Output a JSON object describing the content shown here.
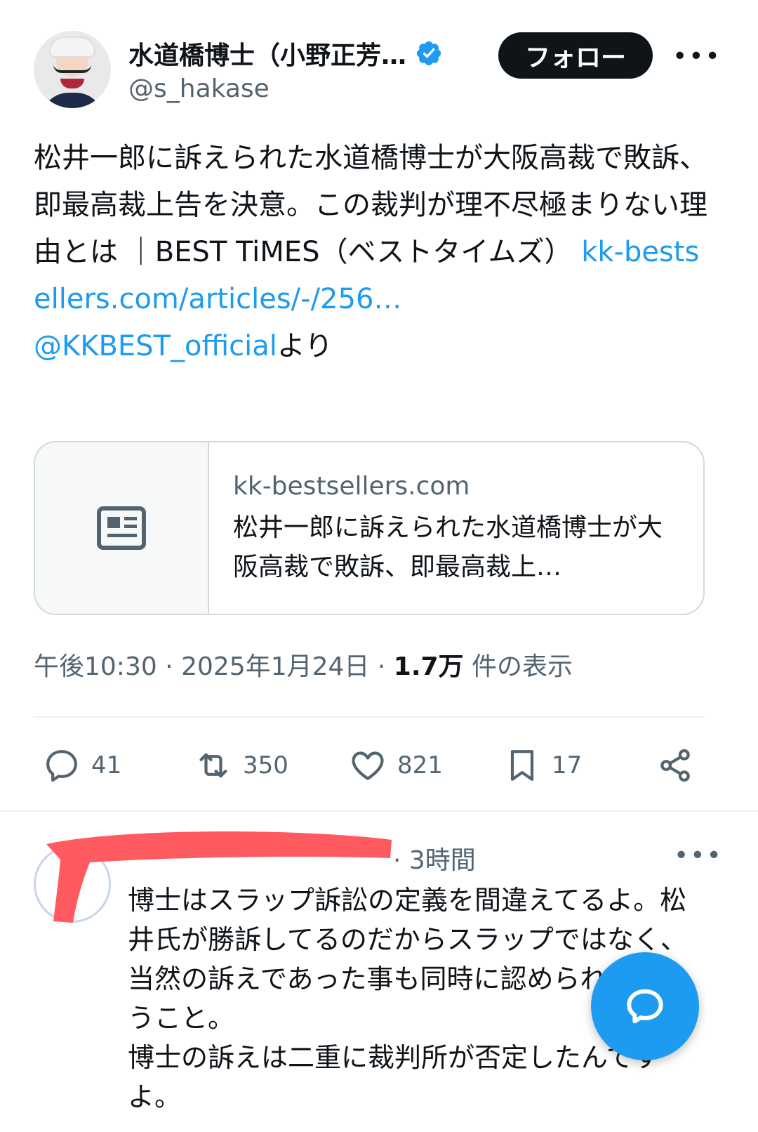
{
  "tweet": {
    "display_name": "水道橋博士（小野正芳…",
    "handle": "@s_hakase",
    "follow_label": "フォロー",
    "more_label": "•••",
    "text_plain": "松井一郎に訴えられた水道橋博士が大阪高裁で敗訴、即最高裁上告を決意。この裁判が理不尽極まりない理由とは ｜BEST TiMES（ベストタイムズ） ",
    "link_text": "kk-bestsellers.com/articles/-/256…",
    "mention": "@KKBEST_official",
    "mention_suffix": "より",
    "card": {
      "domain": "kk-bestsellers.com",
      "title": "松井一郎に訴えられた水道橋博士が大阪高裁で敗訴、即最高裁上…",
      "thumb_icon": "article-icon"
    },
    "meta": {
      "time": "午後10:30",
      "sep": " · ",
      "date": "2025年1月24日",
      "views_count": "1.7万",
      "views_label": " 件の表示"
    },
    "actions": {
      "replies": "41",
      "retweets": "350",
      "likes": "821",
      "bookmarks": "17"
    }
  },
  "reply": {
    "time": "· 3時間",
    "more_label": "•••",
    "text": "博士はスラップ訴訟の定義を間違えてるよ。松井氏が勝訴してるのだからスラップではなく、当然の訴えであった事も同時に認められたということ。\n博士の訴えは二重に裁判所が否定したんですよ。"
  },
  "colors": {
    "link": "#1d9bf0",
    "secondary_text": "#536471",
    "redaction": "#ff5a5f"
  }
}
